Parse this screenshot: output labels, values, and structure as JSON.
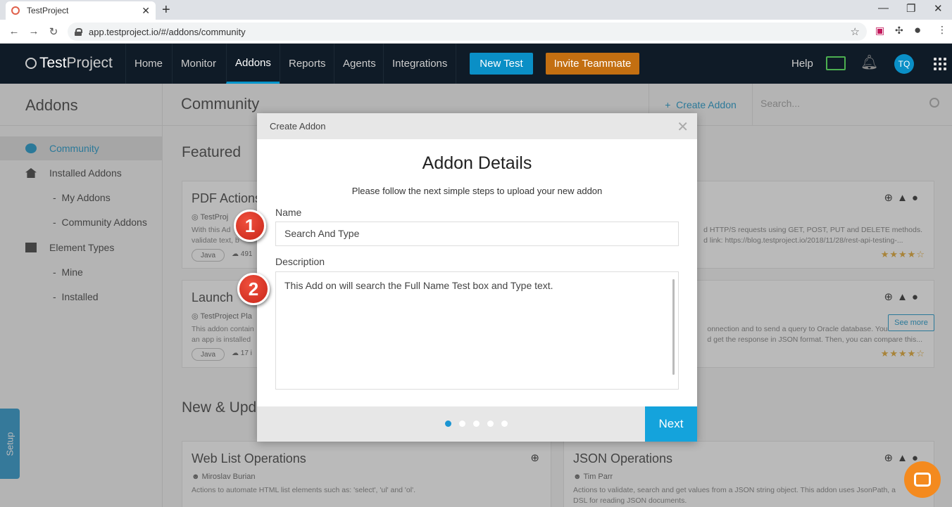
{
  "browser": {
    "tab_title": "TestProject",
    "tab_close": "✕",
    "new_tab": "+",
    "url": "app.testproject.io/#/addons/community",
    "min": "—",
    "max": "❐",
    "close": "✕",
    "back": "←",
    "forward": "→",
    "reload": "↻"
  },
  "header": {
    "logo_a": "Test",
    "logo_b": "Project",
    "menu": [
      "Home",
      "Monitor",
      "Addons",
      "Reports",
      "Agents",
      "Integrations"
    ],
    "new_test": "New Test",
    "invite": "Invite Teammate",
    "help": "Help",
    "avatar": "TQ"
  },
  "sidebar": {
    "title": "Addons",
    "items": [
      "Community",
      "Installed Addons",
      "My Addons",
      "Community Addons",
      "Element Types",
      "Mine",
      "Installed"
    ]
  },
  "main": {
    "title": "Community",
    "create_addon": "Create Addon",
    "search_placeholder": "Search...",
    "featured": "Featured",
    "new_updated": "New & Upd",
    "see_more": "See more",
    "setup": "Setup"
  },
  "cards": {
    "pdf_title": "PDF Actions",
    "pdf_author": "TestProj",
    "pdf_desc1": "With this Ad",
    "pdf_desc2": "validate text, b",
    "pdf_tag": "Java",
    "pdf_dl": "491",
    "launch_title": "Launch",
    "launch_author": "TestProject Pla",
    "launch_desc1": "This addon contain",
    "launch_desc2": "an app is installed",
    "launch_tag": "Java",
    "launch_dl": "17 i",
    "http_desc1": "d HTTP/S requests using GET, POST, PUT and DELETE methods.",
    "http_desc2": "d link: https://blog.testproject.io/2018/11/28/rest-api-testing-...",
    "oracle_desc1": "onnection and to send a query to Oracle database. You can use",
    "oracle_desc2": "d get the response in JSON format. Then, you can compare this...",
    "web_title": "Web List Operations",
    "web_author": "Miroslav Burian",
    "web_desc": "Actions to automate HTML list elements such as: 'select', 'ul' and 'ol'.",
    "json_title": "JSON Operations",
    "json_author": "Tim Parr",
    "json_desc1": "Actions to validate, search and get values from a JSON string object. This addon uses JsonPath, a",
    "json_desc2": "DSL for reading JSON documents.",
    "stars": "★★★★☆"
  },
  "modal": {
    "header_title": "Create Addon",
    "close": "✕",
    "heading": "Addon Details",
    "subtitle": "Please follow the next simple steps to upload your new addon",
    "name_label": "Name",
    "name_value": "Search And Type",
    "description_label": "Description",
    "description_value": "This Add on will search the Full Name Test box and Type text.",
    "next": "Next",
    "steps_total": 5,
    "step_current": 1
  },
  "callouts": [
    "1",
    "2"
  ],
  "colors": {
    "accent": "#0a8fc6",
    "invite": "#c36f11",
    "header_bg": "#0f1b27",
    "callout": "#d9321f"
  }
}
